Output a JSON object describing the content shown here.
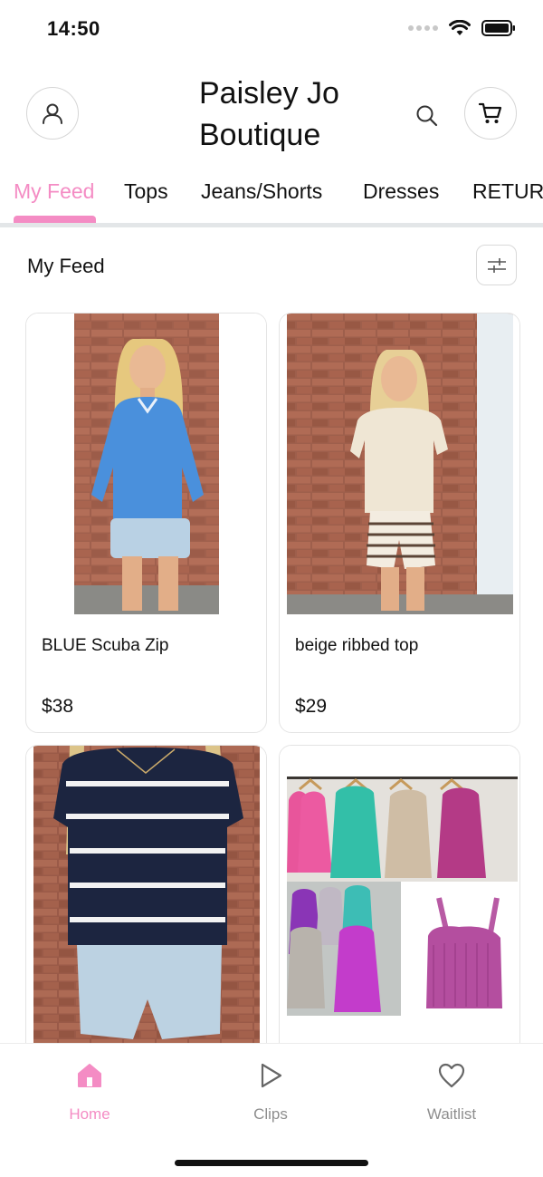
{
  "status_bar": {
    "time": "14:50"
  },
  "header": {
    "brand_line1": "Paisley Jo",
    "brand_line2": "Boutique"
  },
  "tabs": [
    {
      "label": "My Feed",
      "active": true
    },
    {
      "label": "Tops"
    },
    {
      "label": "Jeans/Shorts"
    },
    {
      "label": "Dresses"
    },
    {
      "label": "RETURN"
    }
  ],
  "feed": {
    "title": "My Feed"
  },
  "products": [
    {
      "name": "BLUE Scuba Zip",
      "price": "$38"
    },
    {
      "name": "beige ribbed top",
      "price": "$29"
    },
    {
      "name": "",
      "price": ""
    },
    {
      "name": "",
      "price": ""
    }
  ],
  "bottom_nav": [
    {
      "label": "Home",
      "icon": "home-icon",
      "active": true
    },
    {
      "label": "Clips",
      "icon": "play-icon"
    },
    {
      "label": "Waitlist",
      "icon": "heart-icon"
    }
  ],
  "colors": {
    "accent": "#f48cc4",
    "divider": "#e3e6e8",
    "brick": "#9a5a48",
    "navy": "#1c2540"
  }
}
